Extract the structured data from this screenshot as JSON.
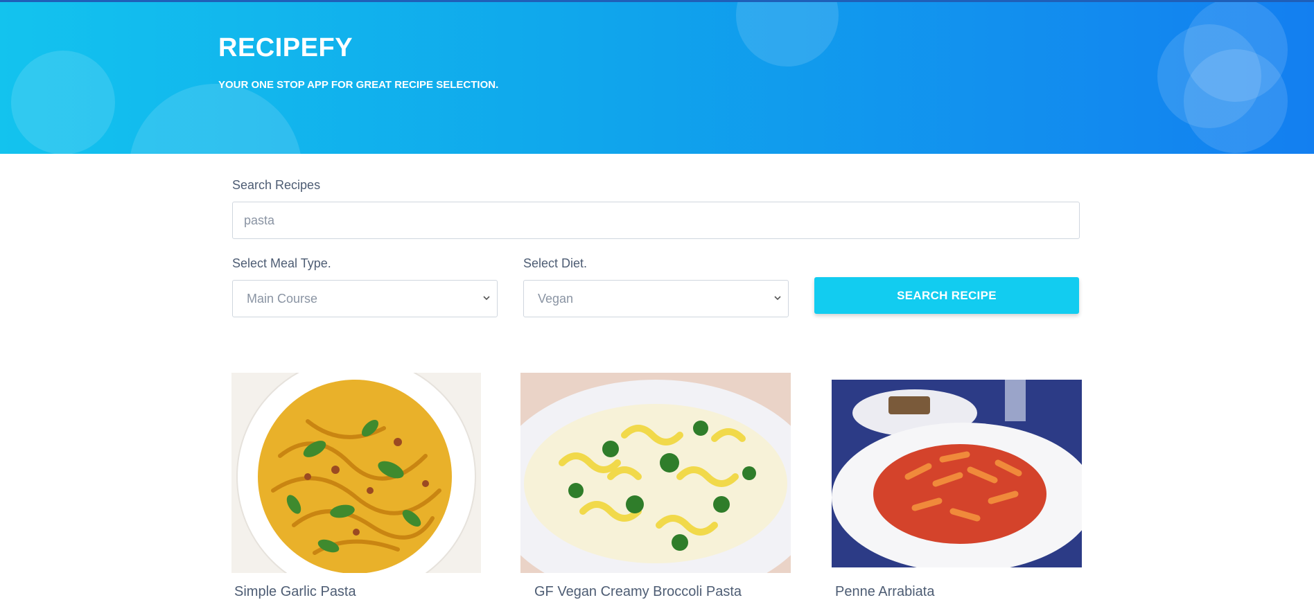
{
  "header": {
    "brand": "RECIPEFY",
    "tagline": "YOUR ONE STOP APP FOR GREAT RECIPE SELECTION."
  },
  "search": {
    "label": "Search Recipes",
    "value": "pasta"
  },
  "filters": {
    "meal_type_label": "Select Meal Type.",
    "meal_type_value": "Main Course",
    "diet_label": "Select Diet.",
    "diet_value": "Vegan",
    "submit_label": "SEARCH RECIPE"
  },
  "recipes": [
    {
      "title": "Simple Garlic Pasta"
    },
    {
      "title": "GF Vegan Creamy Broccoli Pasta"
    },
    {
      "title": "Penne Arrabiata"
    }
  ],
  "colors": {
    "accent": "#12ccf0",
    "header_gradient_start": "#13c3ee",
    "header_gradient_end": "#137ff0"
  }
}
